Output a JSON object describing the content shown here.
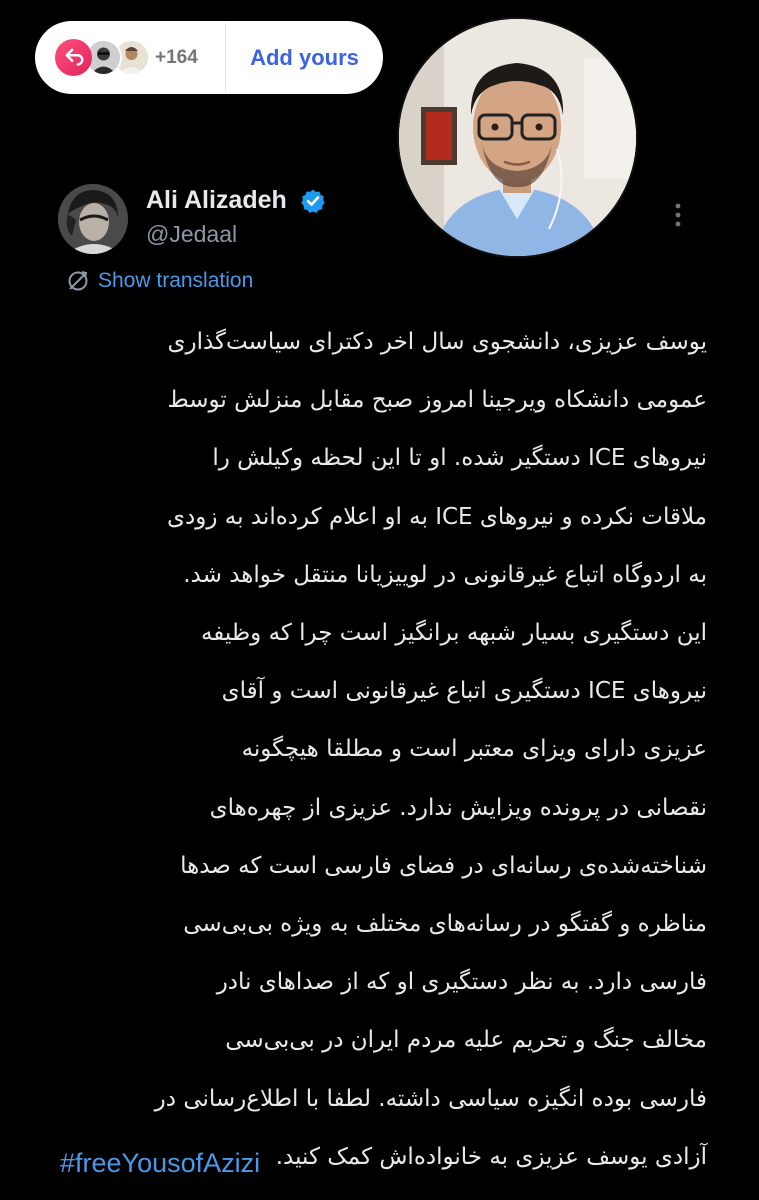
{
  "sticker": {
    "count": "+164",
    "add_label": "Add yours",
    "reply_icon": "reply-arrow-icon",
    "accent_color": "#3c63e0",
    "reply_color": "#e0245e"
  },
  "tweet": {
    "author_name": "Ali Alizadeh",
    "author_handle": "@Jedaal",
    "verified_icon": "verified-badge-icon",
    "translate_label": "Show translation",
    "body_lines": [
      "یوسف عزیزی، دانشجوی سال اخر دکترای سیاست‌گذاری",
      "عمومی دانشکاه ویرجینا امروز صبح مقابل منزلش توسط",
      "نیروهای ICE دستگیر شده. او تا این لحظه وکیلش را",
      "ملاقات نکرده و نیروهای ICE به او اعلام کرده‌اند به زودی",
      "به اردوگاه اتباع غیرقانونی در لوییزیانا منتقل خواهد شد.",
      "این دستگیری بسیار شبهه برانگیز است چرا که وظیفه",
      "نیروهای ICE دستگیری اتباع غیرقانونی است و آقای",
      "عزیزی دارای ویزای معتبر است و مطلقا هیچگونه",
      "نقصانی در پرونده ویزایش ندارد. عزیزی از چهره‌های",
      "شناخته‌شده‌ی رسانه‌ای در فضای فارسی است که صدها",
      "مناظره و گفتگو در رسانه‌های مختلف به ویژه بی‌بی‌سی",
      "فارسی دارد. به نظر دستگیری او که از صداهای نادر",
      "مخالف جنگ و تحریم علیه مردم ایران در بی‌بی‌سی",
      "فارسی بوده انگیزه سیاسی داشته. لطفا با اطلاع‌رسانی در",
      "آزادی یوسف عزیزی به خانواده‌اش کمک کنید."
    ],
    "hashtag": "#freeYousofAzizi",
    "link_color": "#4a99e9"
  }
}
